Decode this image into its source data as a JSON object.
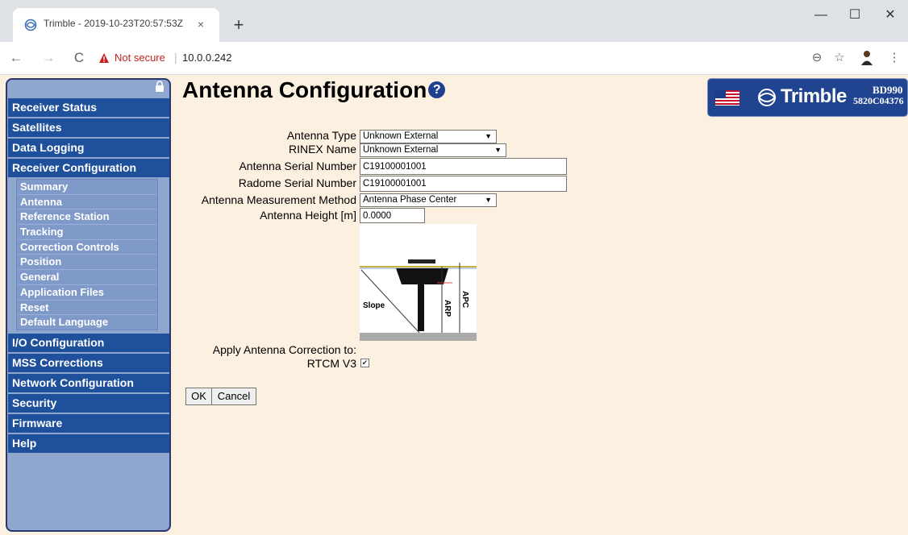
{
  "browser": {
    "tab_title": "Trimble - 2019-10-23T20:57:53Z",
    "tab_close": "×",
    "new_tab": "+",
    "not_secure": "Not secure",
    "url": "10.0.0.242",
    "window_controls": {
      "minimize": "—",
      "maximize": "☐",
      "close": "✕"
    }
  },
  "sidebar": {
    "items": [
      {
        "label": "Receiver Status"
      },
      {
        "label": "Satellites"
      },
      {
        "label": "Data Logging"
      },
      {
        "label": "Receiver Configuration"
      }
    ],
    "subitems": [
      "Summary",
      "Antenna",
      "Reference Station",
      "Tracking",
      "Correction Controls",
      "Position",
      "General",
      "Application Files",
      "Reset",
      "Default Language"
    ],
    "items_after": [
      {
        "label": "I/O Configuration"
      },
      {
        "label": "MSS Corrections"
      },
      {
        "label": "Network Configuration"
      },
      {
        "label": "Security"
      },
      {
        "label": "Firmware"
      },
      {
        "label": "Help"
      }
    ]
  },
  "page": {
    "title": "Antenna Configuration",
    "help_glyph": "?"
  },
  "logo": {
    "brand": "Trimble",
    "model": "BD990",
    "serial": "5820C04376"
  },
  "form": {
    "antenna_type_label": "Antenna Type",
    "antenna_type_value": "Unknown External",
    "rinex_name_label": "RINEX Name",
    "rinex_name_value": "Unknown External",
    "antenna_serial_label": "Antenna Serial Number",
    "antenna_serial_value": "C19100001001",
    "radome_serial_label": "Radome Serial Number",
    "radome_serial_value": "C19100001001",
    "measurement_method_label": "Antenna Measurement Method",
    "measurement_method_value": "Antenna Phase Center",
    "antenna_height_label": "Antenna Height [m]",
    "antenna_height_value": "0.0000",
    "apply_correction_label": "Apply Antenna Correction to:",
    "rtcm_label": "RTCM V3",
    "rtcm_checked": "✔",
    "ok_label": "OK",
    "cancel_label": "Cancel"
  },
  "diagram": {
    "slope_label": "Slope",
    "arp_label": "ARP",
    "apc_label": "APC"
  },
  "colors": {
    "page_bg": "#fcf1e1",
    "menu_bg": "#1f509c",
    "sidebar_bg": "#8fa6cf",
    "logo_bg": "#20448f"
  }
}
